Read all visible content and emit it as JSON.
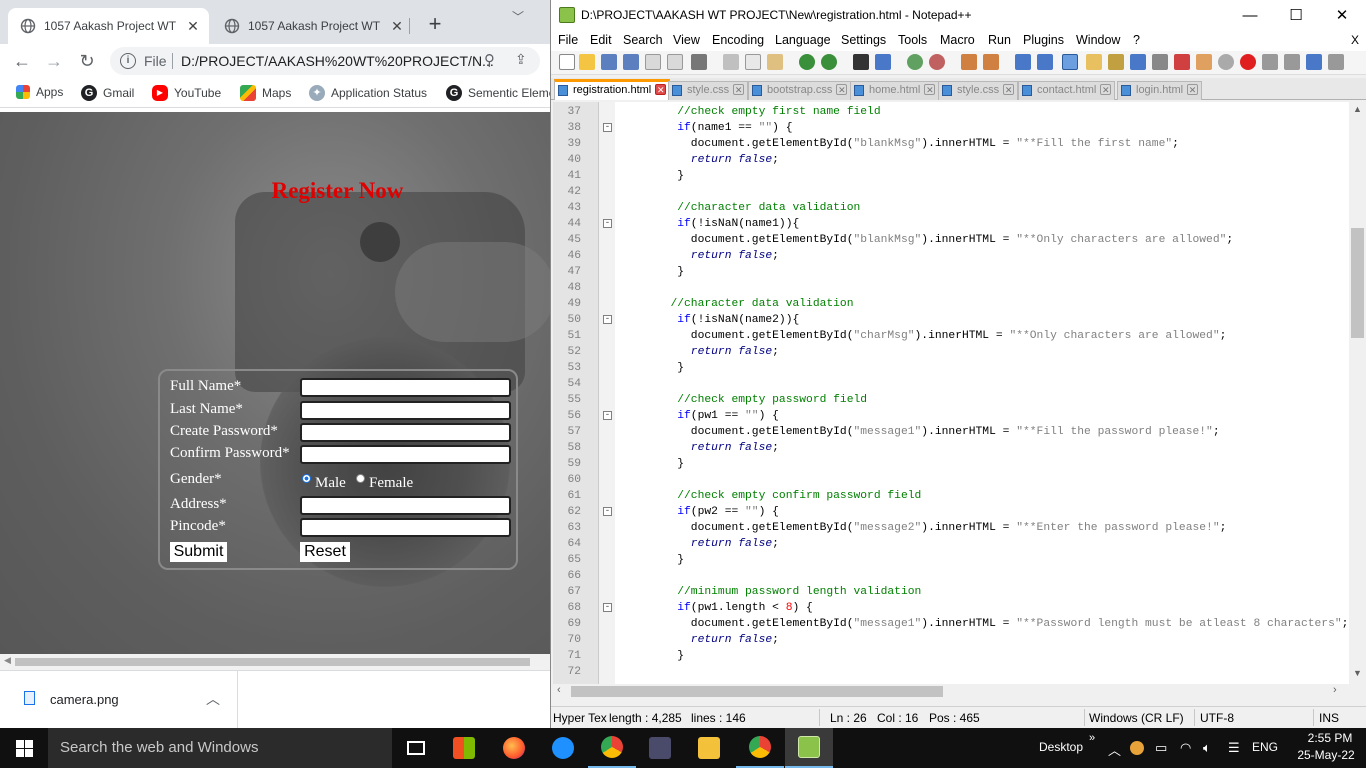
{
  "chrome": {
    "tabs": [
      {
        "title": "1057 Aakash Project WT",
        "active": true
      },
      {
        "title": "1057 Aakash Project WT",
        "active": false
      }
    ],
    "new_tab_symbol": "+",
    "omnibox": {
      "scheme_label": "File",
      "url": "D:/PROJECT/AAKASH%20WT%20PROJECT/N..."
    },
    "bookmarks": [
      {
        "label": "Apps",
        "icon": "apps-grid-icon"
      },
      {
        "label": "Gmail",
        "icon": "google-icon"
      },
      {
        "label": "YouTube",
        "icon": "youtube-icon"
      },
      {
        "label": "Maps",
        "icon": "maps-icon"
      },
      {
        "label": "Application Status",
        "icon": "application-status-icon"
      },
      {
        "label": "Sementic Eleme",
        "icon": "google-icon"
      }
    ],
    "page": {
      "heading": "Register Now",
      "form": {
        "full_name_label": "Full Name*",
        "last_name_label": "Last Name*",
        "create_password_label": "Create Password*",
        "confirm_password_label": "Confirm Password*",
        "gender_label": "Gender*",
        "male_label": "Male",
        "female_label": "Female",
        "address_label": "Address*",
        "pincode_label": "Pincode*",
        "submit_label": "Submit",
        "reset_label": "Reset"
      }
    },
    "download": {
      "filename": "camera.png"
    }
  },
  "npp": {
    "title": "D:\\PROJECT\\AAKASH WT PROJECT\\New\\registration.html - Notepad++",
    "menu": [
      "File",
      "Edit",
      "Search",
      "View",
      "Encoding",
      "Language",
      "Settings",
      "Tools",
      "Macro",
      "Run",
      "Plugins",
      "Window",
      "?"
    ],
    "menu_close": "X",
    "tabs": [
      {
        "label": "registration.html",
        "active": true
      },
      {
        "label": "style.css",
        "active": false
      },
      {
        "label": "bootstrap.css",
        "active": false
      },
      {
        "label": "home.html",
        "active": false
      },
      {
        "label": "style.css",
        "active": false
      },
      {
        "label": "contact.html",
        "active": false
      },
      {
        "label": "login.html",
        "active": false
      }
    ],
    "lines": [
      {
        "n": "37",
        "fold": "",
        "tokens": [
          [
            "c-comment",
            "        //check empty first name field"
          ]
        ]
      },
      {
        "n": "38",
        "fold": "-",
        "tokens": [
          [
            "c-kw",
            "        if"
          ],
          [
            "c-id",
            "(name1 == "
          ],
          [
            "c-str",
            "\"\""
          ],
          [
            "c-id",
            ") {"
          ]
        ]
      },
      {
        "n": "39",
        "fold": "",
        "tokens": [
          [
            "c-id",
            "          document.getElementById("
          ],
          [
            "c-str",
            "\"blankMsg\""
          ],
          [
            "c-id",
            ").innerHTML = "
          ],
          [
            "c-str",
            "\"**Fill the first name\""
          ],
          [
            "c-id",
            ";"
          ]
        ]
      },
      {
        "n": "40",
        "fold": "",
        "tokens": [
          [
            "c-ret",
            "          return false"
          ],
          [
            "c-id",
            ";"
          ]
        ]
      },
      {
        "n": "41",
        "fold": "",
        "tokens": [
          [
            "c-id",
            "        }"
          ]
        ]
      },
      {
        "n": "42",
        "fold": "",
        "tokens": [
          [
            "c-id",
            ""
          ]
        ]
      },
      {
        "n": "43",
        "fold": "",
        "tokens": [
          [
            "c-comment",
            "        //character data validation"
          ]
        ]
      },
      {
        "n": "44",
        "fold": "-",
        "tokens": [
          [
            "c-kw",
            "        if"
          ],
          [
            "c-id",
            "(!isNaN(name1)){"
          ]
        ]
      },
      {
        "n": "45",
        "fold": "",
        "tokens": [
          [
            "c-id",
            "          document.getElementById("
          ],
          [
            "c-str",
            "\"blankMsg\""
          ],
          [
            "c-id",
            ").innerHTML = "
          ],
          [
            "c-str",
            "\"**Only characters are allowed\""
          ],
          [
            "c-id",
            ";"
          ]
        ]
      },
      {
        "n": "46",
        "fold": "",
        "tokens": [
          [
            "c-ret",
            "          return false"
          ],
          [
            "c-id",
            ";"
          ]
        ]
      },
      {
        "n": "47",
        "fold": "",
        "tokens": [
          [
            "c-id",
            "        }"
          ]
        ]
      },
      {
        "n": "48",
        "fold": "",
        "tokens": [
          [
            "c-id",
            ""
          ]
        ]
      },
      {
        "n": "49",
        "fold": "",
        "tokens": [
          [
            "c-comment",
            "       //character data validation"
          ]
        ]
      },
      {
        "n": "50",
        "fold": "-",
        "tokens": [
          [
            "c-kw",
            "        if"
          ],
          [
            "c-id",
            "(!isNaN(name2)){"
          ]
        ]
      },
      {
        "n": "51",
        "fold": "",
        "tokens": [
          [
            "c-id",
            "          document.getElementById("
          ],
          [
            "c-str",
            "\"charMsg\""
          ],
          [
            "c-id",
            ").innerHTML = "
          ],
          [
            "c-str",
            "\"**Only characters are allowed\""
          ],
          [
            "c-id",
            ";"
          ]
        ]
      },
      {
        "n": "52",
        "fold": "",
        "tokens": [
          [
            "c-ret",
            "          return false"
          ],
          [
            "c-id",
            ";"
          ]
        ]
      },
      {
        "n": "53",
        "fold": "",
        "tokens": [
          [
            "c-id",
            "        }"
          ]
        ]
      },
      {
        "n": "54",
        "fold": "",
        "tokens": [
          [
            "c-id",
            ""
          ]
        ]
      },
      {
        "n": "55",
        "fold": "",
        "tokens": [
          [
            "c-comment",
            "        //check empty password field"
          ]
        ]
      },
      {
        "n": "56",
        "fold": "-",
        "tokens": [
          [
            "c-kw",
            "        if"
          ],
          [
            "c-id",
            "(pw1 == "
          ],
          [
            "c-str",
            "\"\""
          ],
          [
            "c-id",
            ") {"
          ]
        ]
      },
      {
        "n": "57",
        "fold": "",
        "tokens": [
          [
            "c-id",
            "          document.getElementById("
          ],
          [
            "c-str",
            "\"message1\""
          ],
          [
            "c-id",
            ").innerHTML = "
          ],
          [
            "c-str",
            "\"**Fill the password please!\""
          ],
          [
            "c-id",
            ";"
          ]
        ]
      },
      {
        "n": "58",
        "fold": "",
        "tokens": [
          [
            "c-ret",
            "          return false"
          ],
          [
            "c-id",
            ";"
          ]
        ]
      },
      {
        "n": "59",
        "fold": "",
        "tokens": [
          [
            "c-id",
            "        }"
          ]
        ]
      },
      {
        "n": "60",
        "fold": "",
        "tokens": [
          [
            "c-id",
            ""
          ]
        ]
      },
      {
        "n": "61",
        "fold": "",
        "tokens": [
          [
            "c-comment",
            "        //check empty confirm password field"
          ]
        ]
      },
      {
        "n": "62",
        "fold": "-",
        "tokens": [
          [
            "c-kw",
            "        if"
          ],
          [
            "c-id",
            "(pw2 == "
          ],
          [
            "c-str",
            "\"\""
          ],
          [
            "c-id",
            ") {"
          ]
        ]
      },
      {
        "n": "63",
        "fold": "",
        "tokens": [
          [
            "c-id",
            "          document.getElementById("
          ],
          [
            "c-str",
            "\"message2\""
          ],
          [
            "c-id",
            ").innerHTML = "
          ],
          [
            "c-str",
            "\"**Enter the password please!\""
          ],
          [
            "c-id",
            ";"
          ]
        ]
      },
      {
        "n": "64",
        "fold": "",
        "tokens": [
          [
            "c-ret",
            "          return false"
          ],
          [
            "c-id",
            ";"
          ]
        ]
      },
      {
        "n": "65",
        "fold": "",
        "tokens": [
          [
            "c-id",
            "        }"
          ]
        ]
      },
      {
        "n": "66",
        "fold": "",
        "tokens": [
          [
            "c-id",
            ""
          ]
        ]
      },
      {
        "n": "67",
        "fold": "",
        "tokens": [
          [
            "c-comment",
            "        //minimum password length validation"
          ]
        ]
      },
      {
        "n": "68",
        "fold": "-",
        "tokens": [
          [
            "c-kw",
            "        if"
          ],
          [
            "c-id",
            "(pw1.length < "
          ],
          [
            "c-num",
            "8"
          ],
          [
            "c-id",
            ") {"
          ]
        ]
      },
      {
        "n": "69",
        "fold": "",
        "tokens": [
          [
            "c-id",
            "          document.getElementById("
          ],
          [
            "c-str",
            "\"message1\""
          ],
          [
            "c-id",
            ").innerHTML = "
          ],
          [
            "c-str",
            "\"**Password length must be atleast 8 characters\""
          ],
          [
            "c-id",
            ";"
          ]
        ]
      },
      {
        "n": "70",
        "fold": "",
        "tokens": [
          [
            "c-ret",
            "          return false"
          ],
          [
            "c-id",
            ";"
          ]
        ]
      },
      {
        "n": "71",
        "fold": "",
        "tokens": [
          [
            "c-id",
            "        }"
          ]
        ]
      },
      {
        "n": "72",
        "fold": "",
        "tokens": [
          [
            "c-id",
            ""
          ]
        ]
      }
    ],
    "status": {
      "lang": "Hyper Tex",
      "length": "length : 4,285",
      "lines": "lines : 146",
      "ln": "Ln : 26",
      "col": "Col : 16",
      "pos": "Pos : 465",
      "eol": "Windows (CR LF)",
      "encoding": "UTF-8",
      "mode": "INS"
    }
  },
  "taskbar": {
    "search_placeholder": "Search the web and Windows",
    "desktop_label": "Desktop",
    "lang": "ENG",
    "time": "2:55 PM",
    "date": "25-May-22",
    "apps": [
      "task-view-icon",
      "store-icon",
      "firefox-icon",
      "edge-icon",
      "chrome-icon",
      "app-icon",
      "file-explorer-icon",
      "chrome-alt-icon",
      "notepadpp-icon"
    ]
  },
  "colors": {
    "heading_red": "#e00000",
    "comment_green": "#008000",
    "keyword_blue": "#0000ff",
    "string_gray": "#808080",
    "tab_accent_orange": "#ff9900"
  }
}
